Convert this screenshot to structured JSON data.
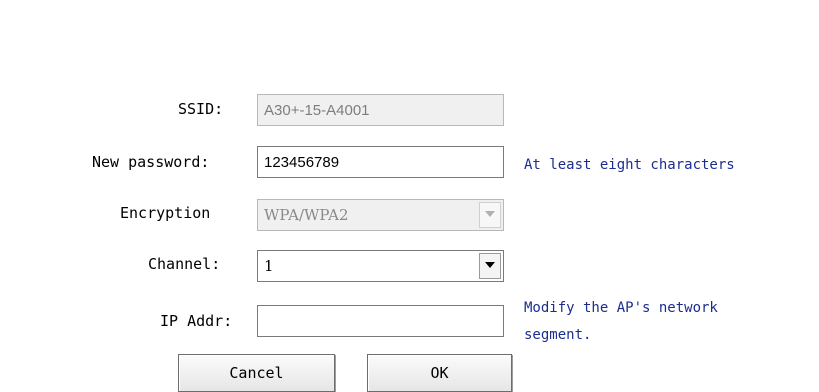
{
  "form": {
    "ssid": {
      "label": "SSID:",
      "value": "A30+-15-A4001",
      "enabled": false
    },
    "password": {
      "label": "New password:",
      "value": "123456789",
      "hint": "At least eight characters"
    },
    "encryption": {
      "label": "Encryption",
      "selected": "WPA/WPA2",
      "enabled": false
    },
    "channel": {
      "label": "Channel:",
      "selected": "1"
    },
    "ip": {
      "label": "IP Addr:",
      "value": "",
      "hint_line1": "Modify the AP's network",
      "hint_line2": "segment."
    }
  },
  "buttons": {
    "cancel": "Cancel",
    "ok": "OK"
  },
  "icons": {
    "dropdown": "chevron-down-icon"
  }
}
